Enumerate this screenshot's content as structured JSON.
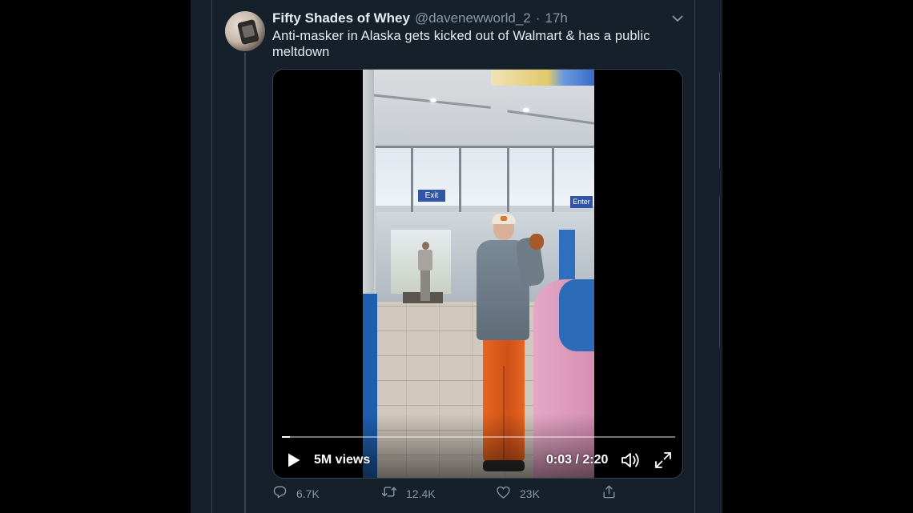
{
  "tweet": {
    "display_name": "Fifty Shades of Whey",
    "handle": "@davenewworld_2",
    "separator": "·",
    "time": "17h",
    "text": "Anti-masker in Alaska gets kicked out of Walmart & has a public meltdown"
  },
  "video": {
    "views": "5M views",
    "time_display": "0:03 / 2:20",
    "progress_fraction": 0.021,
    "signs": {
      "exit": "Exit",
      "enter": "Enter"
    }
  },
  "actions": {
    "reply_count": "6.7K",
    "retweet_count": "12.4K",
    "like_count": "23K"
  },
  "icons": {
    "caret": "chevron-down-icon",
    "play": "play-icon",
    "volume": "volume-muted-icon",
    "fullscreen": "fullscreen-icon",
    "reply": "reply-icon",
    "retweet": "retweet-icon",
    "like": "heart-icon",
    "share": "share-icon"
  },
  "colors": {
    "background": "#15202b",
    "text_primary": "#e6ecf0",
    "text_secondary": "#8899a6",
    "border": "#38444d"
  }
}
